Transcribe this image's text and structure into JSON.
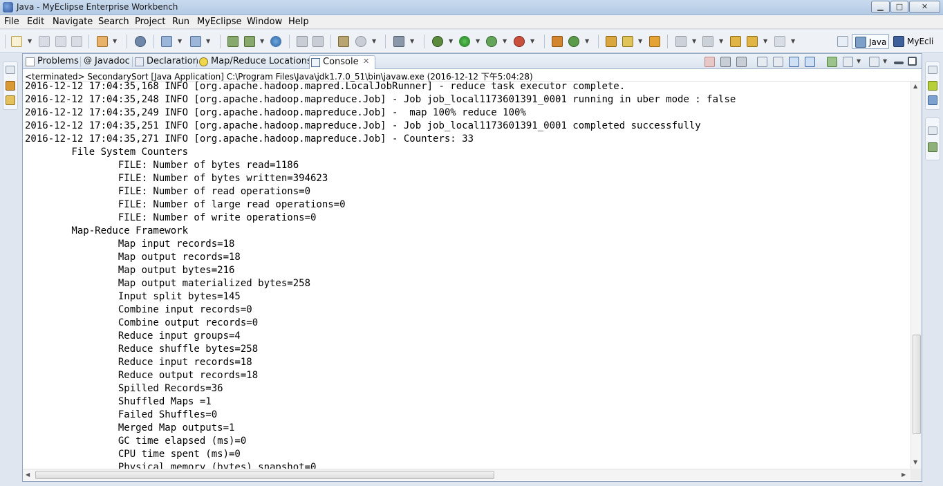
{
  "window": {
    "title": "Java - MyEclipse Enterprise Workbench",
    "minimize_glyph": "▁",
    "maximize_glyph": "□",
    "close_glyph": "✕"
  },
  "menu": [
    "File",
    "Edit",
    "Navigate",
    "Search",
    "Project",
    "Run",
    "MyEclipse",
    "Window",
    "Help"
  ],
  "perspectives": {
    "java": "Java",
    "myeclipse": "MyEcli"
  },
  "tabs": {
    "problems": "Problems",
    "javadoc": "Javadoc",
    "declaration": "Declaration",
    "mapreduce": "Map/Reduce Locations",
    "console": "Console",
    "close_glyph": "✕"
  },
  "console": {
    "description": "<terminated> SecondarySort [Java Application] C:\\Program Files\\Java\\jdk1.7.0_51\\bin\\javaw.exe (2016-12-12 下午5:04:28)",
    "lines": [
      "2016-12-12 17:04:35,168 INFO [org.apache.hadoop.mapred.LocalJobRunner] - reduce task executor complete.",
      "2016-12-12 17:04:35,248 INFO [org.apache.hadoop.mapreduce.Job] - Job job_local1173601391_0001 running in uber mode : false",
      "2016-12-12 17:04:35,249 INFO [org.apache.hadoop.mapreduce.Job] -  map 100% reduce 100%",
      "2016-12-12 17:04:35,251 INFO [org.apache.hadoop.mapreduce.Job] - Job job_local1173601391_0001 completed successfully",
      "2016-12-12 17:04:35,271 INFO [org.apache.hadoop.mapreduce.Job] - Counters: 33",
      "\tFile System Counters",
      "\t\tFILE: Number of bytes read=1186",
      "\t\tFILE: Number of bytes written=394623",
      "\t\tFILE: Number of read operations=0",
      "\t\tFILE: Number of large read operations=0",
      "\t\tFILE: Number of write operations=0",
      "\tMap-Reduce Framework",
      "\t\tMap input records=18",
      "\t\tMap output records=18",
      "\t\tMap output bytes=216",
      "\t\tMap output materialized bytes=258",
      "\t\tInput split bytes=145",
      "\t\tCombine input records=0",
      "\t\tCombine output records=0",
      "\t\tReduce input groups=4",
      "\t\tReduce shuffle bytes=258",
      "\t\tReduce input records=18",
      "\t\tReduce output records=18",
      "\t\tSpilled Records=36",
      "\t\tShuffled Maps =1",
      "\t\tFailed Shuffles=0",
      "\t\tMerged Map outputs=1",
      "\t\tGC time elapsed (ms)=0",
      "\t\tCPU time spent (ms)=0",
      "\t\tPhysical memory (bytes) snapshot=0"
    ]
  },
  "scroll": {
    "up": "▲",
    "down": "▼",
    "left": "◀",
    "right": "▶"
  }
}
